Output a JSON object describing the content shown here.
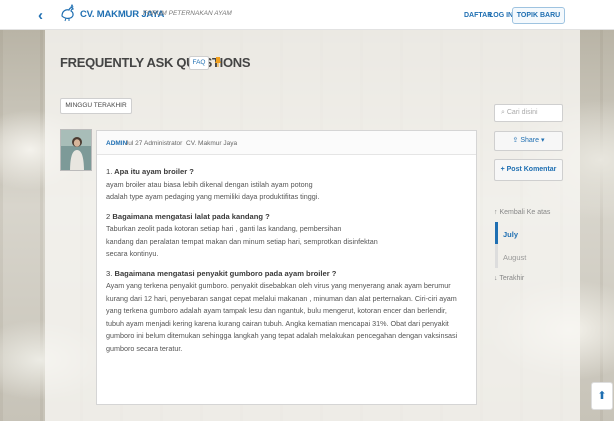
{
  "header": {
    "back_glyph": "‹",
    "brand": "CV. MAKMUR JAYA",
    "tagline": "FORUM PETERNAKAN AYAM",
    "signup": "DAFTAR",
    "login": "LOG IN",
    "new_topic": "TOPIK BARU"
  },
  "topic": {
    "title": "FREQUENTLY ASK QUESTIONS",
    "category": "FAQ",
    "sort_label": "MINGGU TERAKHIR"
  },
  "post": {
    "author": "ADMIN",
    "date": "Jul 27",
    "role": "Administrator",
    "company": "CV. Makmur Jaya",
    "qa": [
      {
        "num": "1.",
        "question": "Apa itu ayam broiler ?",
        "answer_lines": [
          "ayam broiler atau biasa lebih dikenal dengan istilah ayam potong",
          "adalah type ayam pedaging yang memiliki daya produktifitas tinggi."
        ]
      },
      {
        "num": "2",
        "question": "Bagaimana mengatasi lalat pada kandang ?",
        "answer_lines": [
          "Taburkan zeolit pada kotoran setiap hari , ganti las kandang, pembersihan",
          "kandang dan peralatan tempat makan dan minum setiap hari, semprotkan disinfektan",
          "secara kontinyu."
        ]
      },
      {
        "num": "3.",
        "question": "Bagaimana mengatasi penyakit gumboro pada ayam broiler ?",
        "answer_lines": [
          "Ayam yang terkena penyakit gumboro. penyakit disebabkan oleh virus yang menyerang anak ayam berumur",
          "kurang dari 12 hari, penyebaran sangat cepat melalui makanan , minuman dan alat perternakan. Ciri-ciri ayam",
          "yang terkena gumboro adalah ayam tampak lesu dan ngantuk, bulu mengerut, kotoran encer dan berlendir,",
          "tubuh ayam menjadi kering karena kurang cairan tubuh. Angka kematian mencapai 31%. Obat dari penyakit",
          "gumboro ini belum ditemukan sehingga langkah yang tepat adalah melakukan pencegahan dengan vaksinsasi",
          "gumboro secara teratur."
        ]
      }
    ]
  },
  "sidebar": {
    "search_placeholder": "Cari disini",
    "share": "Share",
    "share_caret": "▾",
    "post_comment": "Post Komentar",
    "back_to_top": "Kembali Ke atas",
    "months": [
      "July",
      "August"
    ],
    "latest": "Terakhir"
  },
  "colors": {
    "accent": "#1f6fb2",
    "pin": "#f0a020"
  }
}
